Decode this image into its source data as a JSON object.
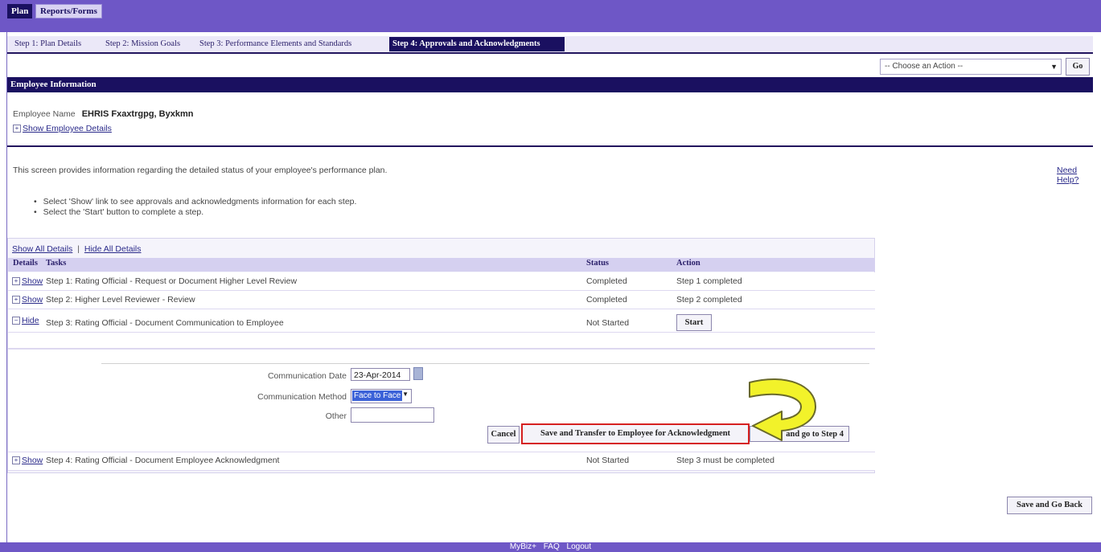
{
  "top_tabs": [
    "Plan",
    "Reports/Forms"
  ],
  "step_tabs": [
    "Step 1: Plan Details",
    "Step 2: Mission Goals",
    "Step 3: Performance Elements and Standards",
    "Step 4: Approvals and Acknowledgments"
  ],
  "action_select": {
    "value": "-- Choose an Action --",
    "go_label": "Go"
  },
  "section_header": "Employee Information",
  "employee": {
    "name_label": "Employee Name",
    "name_value": "EHRIS Fxaxtrgpg, Byxkmn",
    "show_details": "Show Employee Details"
  },
  "intro_text": "This screen provides information regarding the detailed status of your employee's performance plan.",
  "need_help": "Need Help?",
  "bullets": [
    "Select 'Show' link to see approvals and acknowledgments information for each step.",
    "Select the 'Start' button to complete a step."
  ],
  "detail_links": {
    "show_all": "Show All Details",
    "hide_all": "Hide All Details"
  },
  "table": {
    "headers": {
      "details": "Details",
      "tasks": "Tasks",
      "status": "Status",
      "action": "Action"
    },
    "rows": [
      {
        "toggle": "Show",
        "task": "Step 1: Rating Official - Request or Document Higher Level Review",
        "status": "Completed",
        "action": "Step 1 completed"
      },
      {
        "toggle": "Show",
        "task": "Step 2: Higher Level Reviewer - Review",
        "status": "Completed",
        "action": "Step 2 completed"
      },
      {
        "toggle": "Hide",
        "task": "Step 3: Rating Official - Document Communication to Employee",
        "status": "Not Started",
        "action": "Start"
      },
      {
        "toggle": "Show",
        "task": "Step 4: Rating Official - Document Employee Acknowledgment",
        "status": "Not Started",
        "action": "Step 3 must be completed"
      }
    ]
  },
  "detail_form": {
    "date_label": "Communication Date",
    "date_value": "23-Apr-2014",
    "method_label": "Communication Method",
    "method_value": "Face to Face",
    "other_label": "Other",
    "other_value": "",
    "cancel": "Cancel",
    "save_transfer": "Save and Transfer to Employee for Acknowledgment",
    "go_step4": "and go to Step 4"
  },
  "save_go_back": "Save and Go Back",
  "footer": [
    "MyBiz+",
    "FAQ",
    "Logout"
  ],
  "colors": {
    "header_bg": "#6e57c6",
    "dark_navy": "#1a1060",
    "highlight_red": "#d62020",
    "arrow_yellow": "#f2f22a"
  }
}
